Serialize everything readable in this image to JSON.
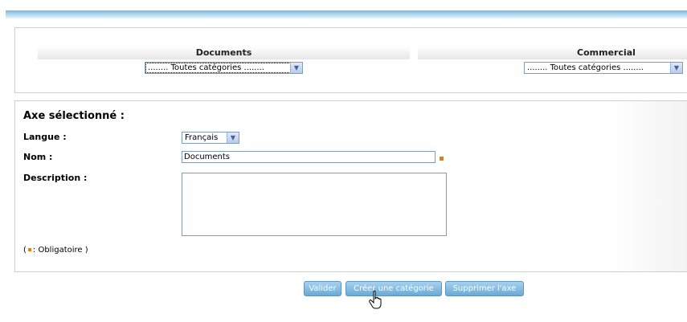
{
  "axes": [
    {
      "title": "Documents",
      "select_value": "........ Toutes catégories ........"
    },
    {
      "title": "Commercial",
      "select_value": "........ Toutes catégories ........"
    }
  ],
  "form": {
    "section_title": "Axe sélectionné :",
    "langue_label": "Langue :",
    "langue_value": "Français",
    "nom_label": "Nom :",
    "nom_value": "Documents",
    "description_label": "Description :",
    "description_value": "",
    "legend_open": "(",
    "legend_text": ": Obligatoire )"
  },
  "buttons": {
    "valider": "Valider",
    "creer": "Créer une catégorie",
    "supprimer": "Supprimer l'axe"
  },
  "colors": {
    "required_marker": "#f07d00",
    "button_bg": "#6aaad6",
    "top_bar": "#7ab8dc"
  },
  "icons": {
    "dropdown": "chevron-down-icon",
    "cursor": "hand-pointer-icon"
  }
}
